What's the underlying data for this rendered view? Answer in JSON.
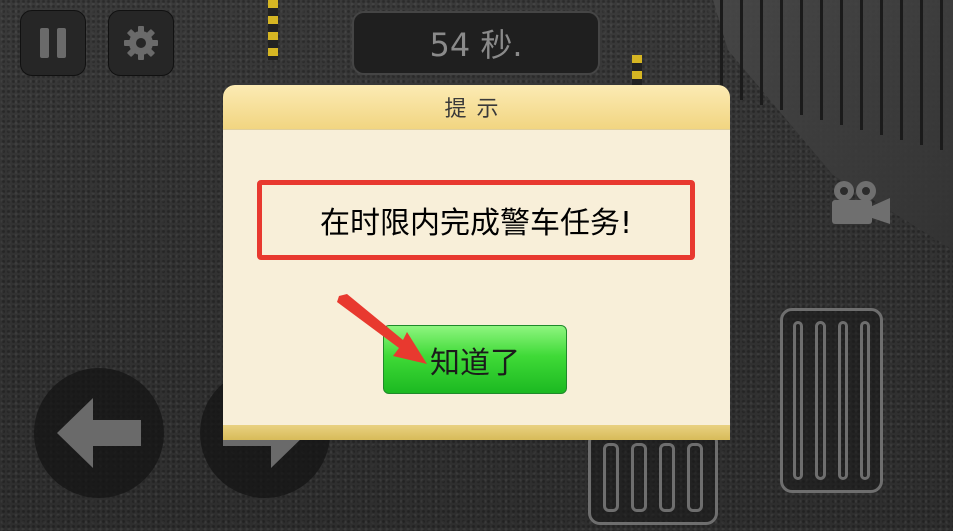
{
  "hud": {
    "pause_icon": "pause-icon",
    "settings_icon": "gear-icon",
    "timer_text": "54 秒."
  },
  "dialog": {
    "title": "提示",
    "message": "在时限内完成警车任务!",
    "confirm_label": "知道了"
  },
  "controls": {
    "left_icon": "arrow-left-icon",
    "right_icon": "arrow-right-icon",
    "camera_icon": "camera-icon",
    "brake_icon": "brake-pedal-icon",
    "gas_icon": "gas-pedal-icon"
  },
  "colors": {
    "highlight_border": "#e8392f",
    "confirm_button": "#3fda37",
    "dialog_header": "#f1d581"
  }
}
